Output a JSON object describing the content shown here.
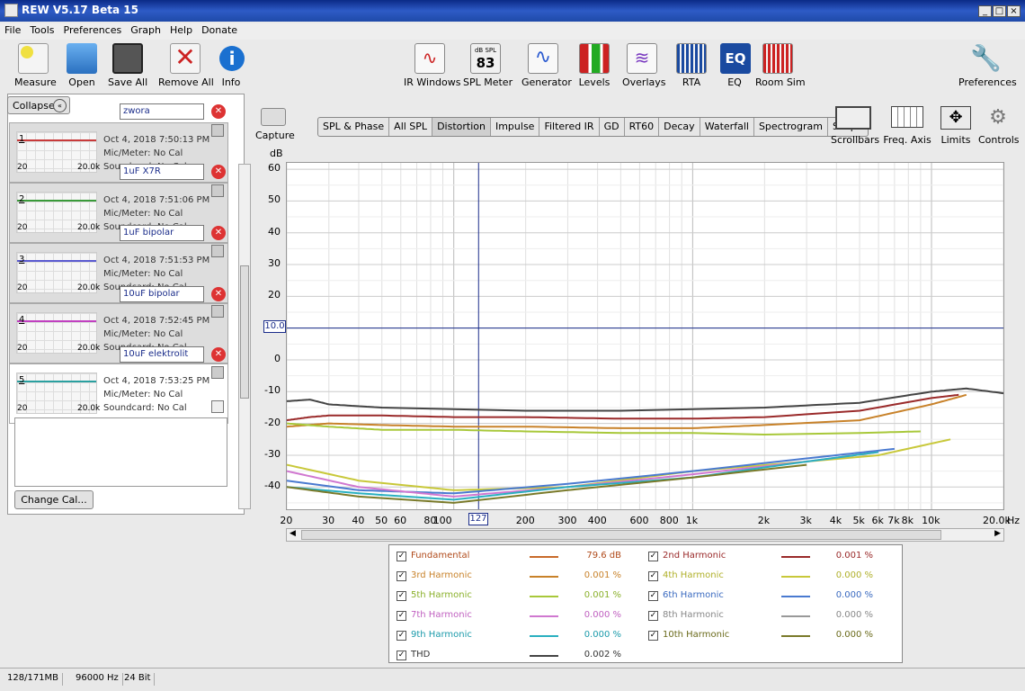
{
  "window": {
    "title": "REW V5.17 Beta 15"
  },
  "menu": [
    "File",
    "Tools",
    "Preferences",
    "Graph",
    "Help",
    "Donate"
  ],
  "toolbar": {
    "left": [
      "Measure",
      "Open",
      "Save All",
      "Remove All",
      "Info"
    ],
    "center": [
      "IR Windows",
      "SPL Meter",
      "Generator",
      "Levels",
      "Overlays",
      "RTA",
      "EQ",
      "Room Sim"
    ],
    "spl_meter_caption": "dB SPL",
    "spl_meter_value": "83",
    "eq_glyph": "EQ",
    "right": "Preferences"
  },
  "panel": {
    "collapse": "Collapse",
    "change_cal": "Change Cal...",
    "measurements": [
      {
        "num": "1",
        "name": "zwora",
        "date": "Oct 4, 2018 7:50:13 PM",
        "mic": "Mic/Meter: No Cal",
        "sc": "Soundcard: No Cal",
        "color": "#c83a3a"
      },
      {
        "num": "2",
        "name": "1uF X7R",
        "date": "Oct 4, 2018 7:51:06 PM",
        "mic": "Mic/Meter: No Cal",
        "sc": "Soundcard: No Cal",
        "color": "#3a9a3a"
      },
      {
        "num": "3",
        "name": "1uF bipolar",
        "date": "Oct 4, 2018 7:51:53 PM",
        "mic": "Mic/Meter: No Cal",
        "sc": "Soundcard: No Cal",
        "color": "#5a5ad0"
      },
      {
        "num": "4",
        "name": "10uF bipolar",
        "date": "Oct 4, 2018 7:52:45 PM",
        "mic": "Mic/Meter: No Cal",
        "sc": "Soundcard: No Cal",
        "color": "#c040c0"
      },
      {
        "num": "5",
        "name": "10uF elektrolit",
        "date": "Oct 4, 2018 7:53:25 PM",
        "mic": "Mic/Meter: No Cal",
        "sc": "Soundcard: No Cal",
        "color": "#2aa0a0"
      }
    ],
    "thumb_x_min": "20",
    "thumb_x_max": "20.0k"
  },
  "capture": "Capture",
  "tabs": [
    "SPL & Phase",
    "All SPL",
    "Distortion",
    "Impulse",
    "Filtered IR",
    "GD",
    "RT60",
    "Decay",
    "Waterfall",
    "Spectrogram",
    "Scope"
  ],
  "active_tab": "Distortion",
  "view_controls": [
    "Scrollbars",
    "Freq. Axis",
    "Limits",
    "Controls"
  ],
  "chart_data": {
    "type": "line",
    "ylabel": "dB",
    "xlabel_unit": "Hz",
    "ylim": [
      -47,
      62
    ],
    "xlim": [
      20,
      20000
    ],
    "x_scale": "log",
    "y_ticks": [
      60,
      50,
      40,
      30,
      20,
      10,
      0,
      -10,
      -20,
      -30,
      -40
    ],
    "x_ticks": [
      {
        "v": 20,
        "l": "20"
      },
      {
        "v": 30,
        "l": "30"
      },
      {
        "v": 40,
        "l": "40"
      },
      {
        "v": 50,
        "l": "50"
      },
      {
        "v": 60,
        "l": "60"
      },
      {
        "v": 80,
        "l": "80"
      },
      {
        "v": 100,
        "l": "100"
      },
      {
        "v": 200,
        "l": "200"
      },
      {
        "v": 300,
        "l": "300"
      },
      {
        "v": 400,
        "l": "400"
      },
      {
        "v": 600,
        "l": "600"
      },
      {
        "v": 800,
        "l": "800"
      },
      {
        "v": 1000,
        "l": "1k"
      },
      {
        "v": 2000,
        "l": "2k"
      },
      {
        "v": 3000,
        "l": "3k"
      },
      {
        "v": 4000,
        "l": "4k"
      },
      {
        "v": 5000,
        "l": "5k"
      },
      {
        "v": 6000,
        "l": "6k"
      },
      {
        "v": 7000,
        "l": "7k"
      },
      {
        "v": 8000,
        "l": "8k"
      },
      {
        "v": 10000,
        "l": "10k"
      },
      {
        "v": 20000,
        "l": "20.0k"
      }
    ],
    "cursor": {
      "x": 127,
      "x_label": "127",
      "y": 10,
      "y_label": "10.0"
    },
    "series": [
      {
        "name": "THD",
        "color": "#444444",
        "x": [
          20,
          25,
          30,
          50,
          100,
          200,
          500,
          1000,
          2000,
          5000,
          10000,
          14000,
          20000
        ],
        "y": [
          -13,
          -12.5,
          -14,
          -15,
          -15.5,
          -16,
          -16,
          -15.5,
          -15,
          -13.5,
          -10,
          -9,
          -10.5
        ]
      },
      {
        "name": "2nd Harmonic",
        "color": "#9a2a2a",
        "x": [
          20,
          25,
          30,
          50,
          100,
          200,
          500,
          1000,
          2000,
          5000,
          10000,
          13000
        ],
        "y": [
          -19,
          -18,
          -17.5,
          -17.5,
          -18,
          -18,
          -18.5,
          -18.5,
          -18,
          -16,
          -12,
          -11
        ]
      },
      {
        "name": "3rd Harmonic",
        "color": "#c8822a",
        "x": [
          20,
          30,
          50,
          100,
          200,
          500,
          1000,
          2000,
          5000,
          10000,
          14000
        ],
        "y": [
          -21,
          -20,
          -20.5,
          -21,
          -21,
          -21.5,
          -21.5,
          -20.5,
          -19,
          -14,
          -11
        ]
      },
      {
        "name": "5th Harmonic",
        "color": "#a8c83a",
        "x": [
          20,
          30,
          50,
          100,
          200,
          500,
          1000,
          2000,
          5000,
          9000
        ],
        "y": [
          -20,
          -21,
          -22,
          -22,
          -22.5,
          -23,
          -23,
          -23.5,
          -23,
          -22.5
        ]
      },
      {
        "name": "4th Harmonic",
        "color": "#c8c83a",
        "x": [
          20,
          40,
          100,
          300,
          1000,
          3000,
          6000,
          12000
        ],
        "y": [
          -33,
          -38,
          -41,
          -40,
          -35,
          -32,
          -30,
          -25
        ]
      },
      {
        "name": "6th Harmonic",
        "color": "#4a7ad0",
        "x": [
          20,
          40,
          100,
          300,
          1000,
          3000,
          7000
        ],
        "y": [
          -38,
          -41,
          -42,
          -39,
          -35,
          -31,
          -28
        ]
      },
      {
        "name": "7th Harmonic",
        "color": "#d078d0",
        "x": [
          20,
          40,
          100,
          300,
          1000,
          3000,
          6000
        ],
        "y": [
          -35,
          -40,
          -43,
          -40,
          -36,
          -32,
          -29
        ]
      },
      {
        "name": "9th Harmonic",
        "color": "#2ab0c0",
        "x": [
          20,
          40,
          100,
          300,
          1000,
          3000,
          6000
        ],
        "y": [
          -40,
          -42,
          -44,
          -40,
          -37,
          -32,
          -29
        ]
      },
      {
        "name": "10th Harmonic",
        "color": "#7a7a2a",
        "x": [
          20,
          40,
          100,
          300,
          1000,
          3000
        ],
        "y": [
          -40,
          -43,
          -45,
          -41,
          -37,
          -33
        ]
      }
    ]
  },
  "legend": [
    {
      "name": "Fundamental",
      "value": "79.6 dB",
      "color": "#c86a2a",
      "text": "#b04a1a"
    },
    {
      "name": "2nd Harmonic",
      "value": "0.001 %",
      "color": "#9a2a2a",
      "text": "#9a2a2a"
    },
    {
      "name": "3rd Harmonic",
      "value": "0.001 %",
      "color": "#c8822a",
      "text": "#c8822a"
    },
    {
      "name": "4th Harmonic",
      "value": "0.000 %",
      "color": "#c8c83a",
      "text": "#b0b02a"
    },
    {
      "name": "5th Harmonic",
      "value": "0.001 %",
      "color": "#a8c83a",
      "text": "#8ab02a"
    },
    {
      "name": "6th Harmonic",
      "value": "0.000 %",
      "color": "#4a7ad0",
      "text": "#3a6ac0"
    },
    {
      "name": "7th Harmonic",
      "value": "0.000 %",
      "color": "#d078d0",
      "text": "#c060c0"
    },
    {
      "name": "8th Harmonic",
      "value": "0.000 %",
      "color": "#999999",
      "text": "#888888"
    },
    {
      "name": "9th Harmonic",
      "value": "0.000 %",
      "color": "#2ab0c0",
      "text": "#1a9aaa"
    },
    {
      "name": "10th Harmonic",
      "value": "0.000 %",
      "color": "#7a7a2a",
      "text": "#6a6a1a"
    },
    {
      "name": "THD",
      "value": "0.002 %",
      "color": "#444444",
      "text": "#333333"
    }
  ],
  "status": {
    "mem": "128/171MB",
    "rate": "96000 Hz",
    "bits": "24 Bit"
  }
}
